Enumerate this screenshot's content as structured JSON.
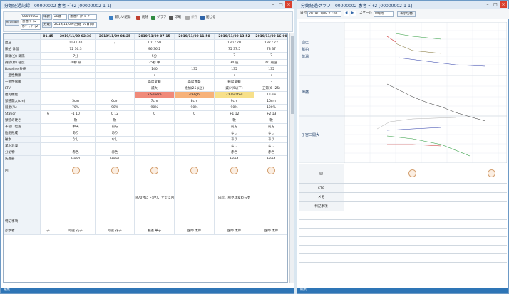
{
  "left_window": {
    "title": "分娩経過記録 - 00000002 患者 ﾃﾞﾓ2 [00000002-1-1]",
    "header": {
      "mode_label": "経過日時",
      "patient_id": "00000002",
      "patient_name": "患者 ﾃﾞﾓ2",
      "patient_kana": "ｶﾝｼﾞｬ ﾃﾞﾓ2",
      "age_label": "年齢",
      "age_value": "28歳",
      "ward": "患者ﾃﾞﾓｸﾞﾙｰﾌﾟ",
      "gest_label": "分娩日",
      "gest_value": "2019/11/09 (妊娠 10日目)"
    },
    "toolbar": {
      "new_record": "新しい記録",
      "delete": "削除",
      "graph": "グラフ",
      "print": "印刷",
      "save": "保存",
      "close": "閉じる"
    },
    "time_columns": [
      "01:45",
      "2019/11/09 02:36",
      "2019/11/09 04:25",
      "2019/11/09 07:15",
      "2019/11/09 11:50",
      "2019/11/09 13:52",
      "2019/11/09 16:00"
    ],
    "rows": [
      {
        "label": "血圧",
        "values": [
          "",
          "113 / 70",
          "/",
          "101 / 59",
          "",
          "130 / 70",
          "132 / 72"
        ]
      },
      {
        "label": "脈拍  体温",
        "values": [
          "",
          "72  36.3",
          "",
          "96  36.2",
          "",
          "75  37.5",
          "78  37"
        ]
      },
      {
        "label": "陣痛(分)  間隔",
        "values": [
          "",
          "7分",
          "",
          "5分",
          "",
          "3",
          "2"
        ]
      },
      {
        "label": "持続(秒)  強度",
        "values": [
          "",
          "30秒  弱",
          "",
          "35秒  中",
          "",
          "30  強",
          "60  最強"
        ]
      },
      {
        "label": "Baseline  FHR",
        "values": [
          "",
          "",
          "",
          "140",
          "135",
          "135",
          "135"
        ]
      },
      {
        "label": "一過性頻脈",
        "values": [
          "",
          "",
          "",
          "+",
          "",
          "+",
          "+"
        ]
      },
      {
        "label": "一過性徐脈",
        "values": [
          "",
          "",
          "",
          "高度変動",
          "高度遅発",
          "軽度変動",
          "-"
        ]
      },
      {
        "label": "LTV",
        "values": [
          "",
          "",
          "",
          "減失",
          "増加(25以上)",
          "減少(5以下)",
          "正常(6~25)"
        ]
      },
      {
        "label": "胎児機能",
        "values": [
          "",
          "",
          "",
          "5:Severe",
          "4:High",
          "3:Elevated",
          "1:Low"
        ]
      },
      {
        "label": "頸管開大(cm)",
        "values": [
          "",
          "5cm",
          "6cm",
          "7cm",
          "8cm",
          "9cm",
          "10cm"
        ]
      },
      {
        "label": "展退(%)",
        "values": [
          "",
          "70%",
          "90%",
          "90%",
          "90%",
          "90%",
          "100%"
        ]
      },
      {
        "label": "Station",
        "values": [
          "6",
          "-1  10",
          "0  12",
          "0",
          "0",
          "+1  12",
          "+2  13"
        ]
      },
      {
        "label": "頸管の硬さ",
        "values": [
          "",
          "軟",
          "軟",
          "",
          "",
          "軟",
          "軟"
        ]
      },
      {
        "label": "子宮口位置",
        "values": [
          "",
          "中央",
          "前方",
          "",
          "",
          "前方",
          "前方"
        ]
      },
      {
        "label": "胎胞形成",
        "values": [
          "",
          "あり",
          "あり",
          "",
          "",
          "なし",
          "なし"
        ]
      },
      {
        "label": "破水",
        "values": [
          "",
          "なし",
          "なし",
          "",
          "",
          "あり",
          "あり"
        ]
      },
      {
        "label": "羊水混濁",
        "values": [
          "",
          "",
          "",
          "",
          "",
          "なし",
          "なし"
        ]
      },
      {
        "label": "分泌物",
        "values": [
          "",
          "赤色",
          "赤色",
          "",
          "",
          "赤色",
          "赤色"
        ]
      },
      {
        "label": "先進部",
        "values": [
          "",
          "Head",
          "Head",
          "",
          "",
          "Head",
          "Head"
        ]
      },
      {
        "label": "回",
        "values": [
          "",
          "",
          "",
          "",
          "",
          "",
          ""
        ]
      },
      {
        "label": "",
        "values": [
          "",
          "",
          "",
          "FHR70台に下がり、すぐに回る",
          "",
          "内診、所見は変わらず",
          ""
        ]
      },
      {
        "label": "特記事項",
        "values": [
          "",
          "",
          "",
          "",
          "",
          "",
          ""
        ]
      },
      {
        "label": "診察者",
        "values": [
          "子",
          "助産 花子",
          "助産 花子",
          "看護 華子",
          "医師 太郎",
          "医師 太郎",
          "医師 太郎"
        ]
      }
    ],
    "status": "編集"
  },
  "right_window": {
    "title": "分娩経過グラフ - 00000002 患者 ﾃﾞﾓ2 [00000002-1-1]",
    "toolbar": {
      "date_label": "日付",
      "date_value": "2019/11/08 21:00",
      "scale_label": "スケール",
      "scale_value": "8時間",
      "settings": "表示切替"
    },
    "axis_labels": {
      "bp": "血圧",
      "pulse": "脈拍",
      "temp": "体温",
      "contraction": "陣痛",
      "dilation": "子宮口開大"
    },
    "table_rows": [
      "回",
      "CTG",
      "メモ",
      "特記事項"
    ],
    "status": "編集"
  }
}
